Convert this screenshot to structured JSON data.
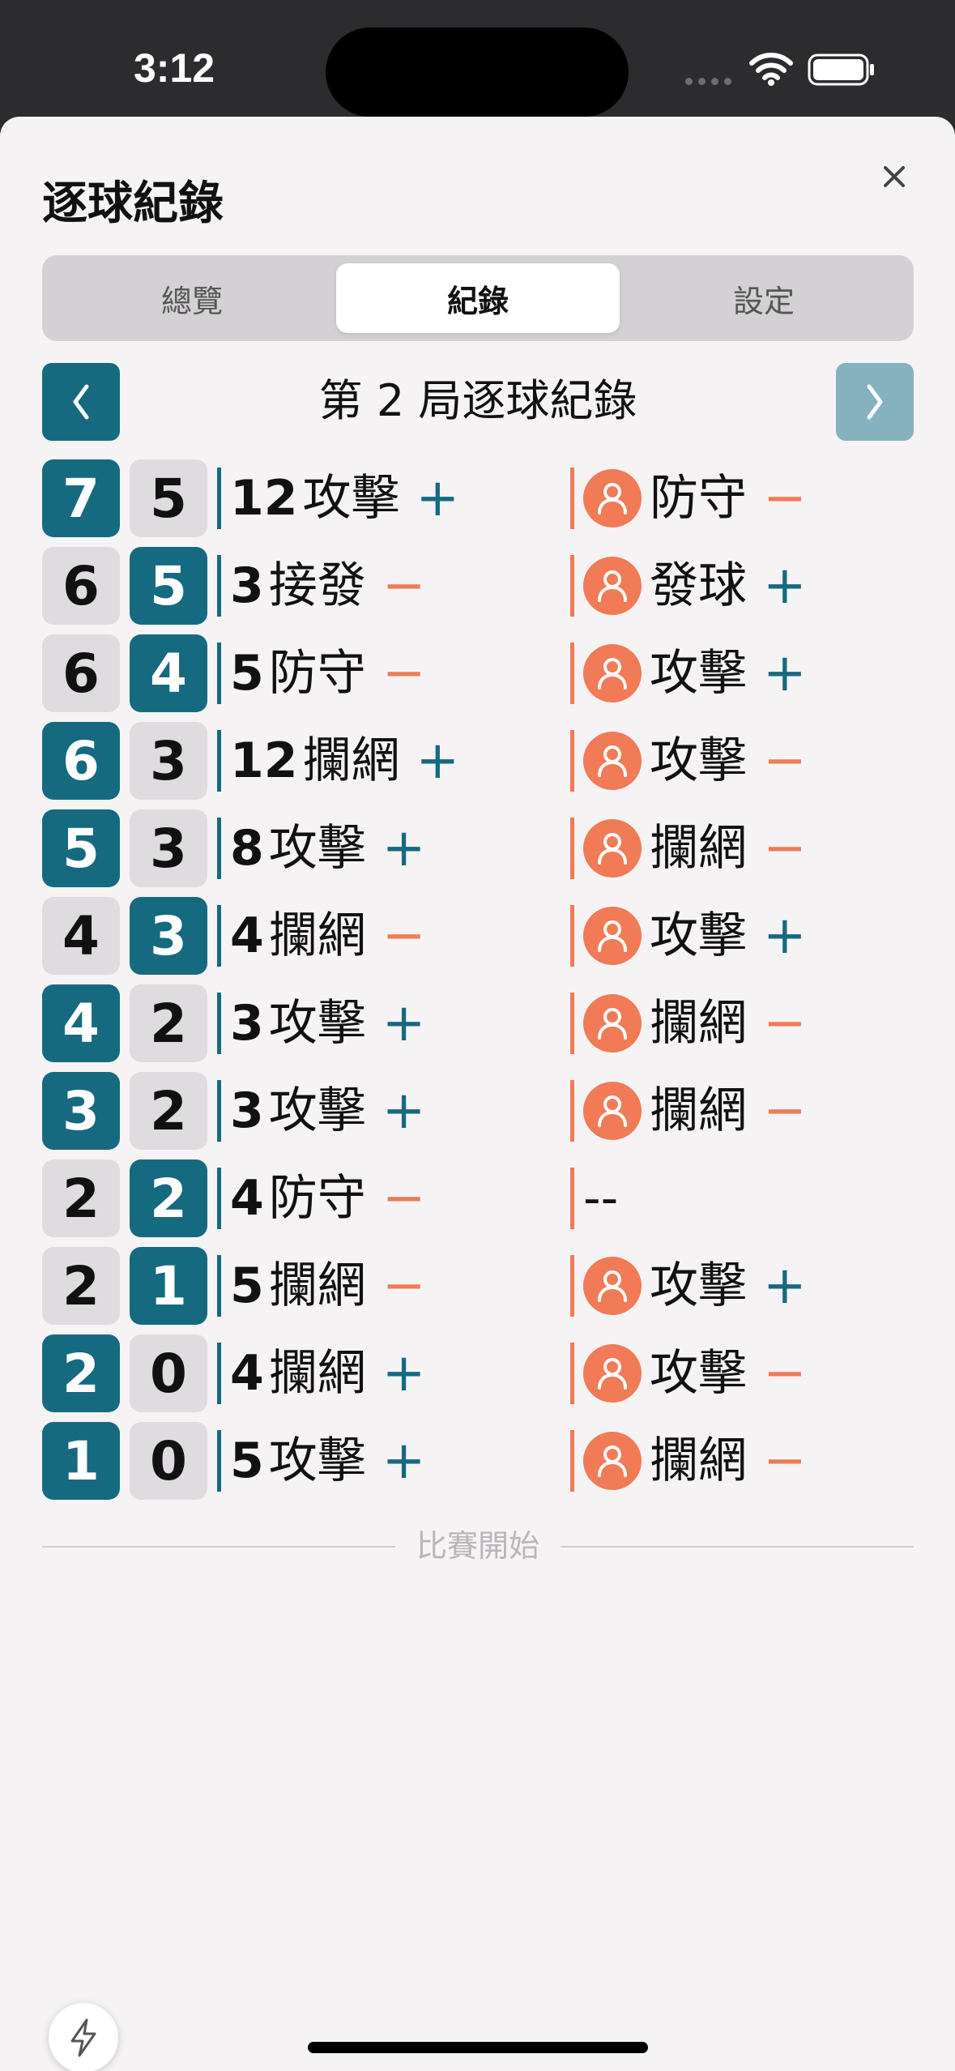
{
  "status": {
    "time": "3:12"
  },
  "sheet": {
    "title": "逐球紀錄",
    "tabs": [
      {
        "label": "總覽",
        "active": false
      },
      {
        "label": "紀錄",
        "active": true
      },
      {
        "label": "設定",
        "active": false
      }
    ],
    "set_title": "第 2 局逐球紀錄",
    "divider_label": "比賽開始"
  },
  "rows": [
    {
      "home": "7",
      "away": "5",
      "winner": "home",
      "our_num": "12",
      "our_action": "攻擊",
      "our_sign": "+",
      "opp_action": "防守",
      "opp_sign": "−",
      "opp_avatar": true
    },
    {
      "home": "6",
      "away": "5",
      "winner": "away",
      "our_num": "3",
      "our_action": "接發",
      "our_sign": "−",
      "opp_action": "發球",
      "opp_sign": "+",
      "opp_avatar": true
    },
    {
      "home": "6",
      "away": "4",
      "winner": "away",
      "our_num": "5",
      "our_action": "防守",
      "our_sign": "−",
      "opp_action": "攻擊",
      "opp_sign": "+",
      "opp_avatar": true
    },
    {
      "home": "6",
      "away": "3",
      "winner": "home",
      "our_num": "12",
      "our_action": "攔網",
      "our_sign": "+",
      "opp_action": "攻擊",
      "opp_sign": "−",
      "opp_avatar": true
    },
    {
      "home": "5",
      "away": "3",
      "winner": "home",
      "our_num": "8",
      "our_action": "攻擊",
      "our_sign": "+",
      "opp_action": "攔網",
      "opp_sign": "−",
      "opp_avatar": true
    },
    {
      "home": "4",
      "away": "3",
      "winner": "away",
      "our_num": "4",
      "our_action": "攔網",
      "our_sign": "−",
      "opp_action": "攻擊",
      "opp_sign": "+",
      "opp_avatar": true
    },
    {
      "home": "4",
      "away": "2",
      "winner": "home",
      "our_num": "3",
      "our_action": "攻擊",
      "our_sign": "+",
      "opp_action": "攔網",
      "opp_sign": "−",
      "opp_avatar": true
    },
    {
      "home": "3",
      "away": "2",
      "winner": "home",
      "our_num": "3",
      "our_action": "攻擊",
      "our_sign": "+",
      "opp_action": "攔網",
      "opp_sign": "−",
      "opp_avatar": true
    },
    {
      "home": "2",
      "away": "2",
      "winner": "away",
      "our_num": "4",
      "our_action": "防守",
      "our_sign": "−",
      "opp_action": "--",
      "opp_sign": "",
      "opp_avatar": false
    },
    {
      "home": "2",
      "away": "1",
      "winner": "away",
      "our_num": "5",
      "our_action": "攔網",
      "our_sign": "−",
      "opp_action": "攻擊",
      "opp_sign": "+",
      "opp_avatar": true
    },
    {
      "home": "2",
      "away": "0",
      "winner": "home",
      "our_num": "4",
      "our_action": "攔網",
      "our_sign": "+",
      "opp_action": "攻擊",
      "opp_sign": "−",
      "opp_avatar": true
    },
    {
      "home": "1",
      "away": "0",
      "winner": "home",
      "our_num": "5",
      "our_action": "攻擊",
      "our_sign": "+",
      "opp_action": "攔網",
      "opp_sign": "−",
      "opp_avatar": true
    }
  ],
  "colors": {
    "teal": "#166a80",
    "orange": "#f07b56",
    "teal_disabled": "#86b2c0"
  },
  "icons": {
    "prev": "chevron-left-icon",
    "next": "chevron-right-icon",
    "close": "close-icon",
    "avatar": "person-icon",
    "fab": "lightning-icon"
  }
}
